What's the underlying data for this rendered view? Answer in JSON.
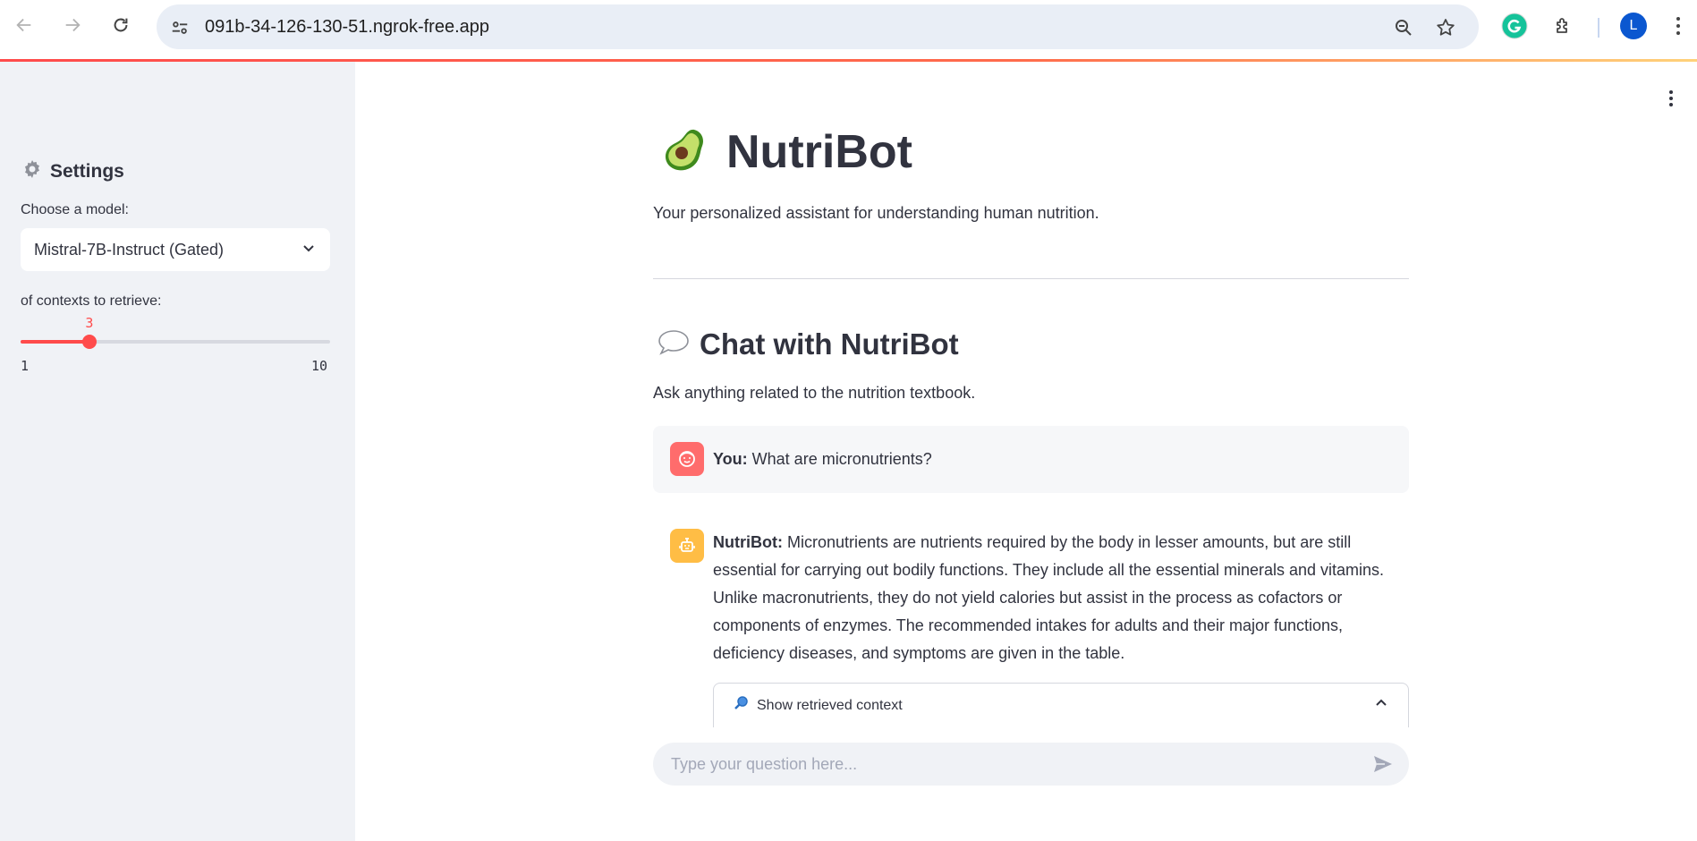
{
  "browser": {
    "url": "091b-34-126-130-51.ngrok-free.app",
    "profile_initial": "L",
    "colors": {
      "omnibox_bg": "#e9eef6",
      "profile": "#0b57d0",
      "grammarly": "#15c39a"
    }
  },
  "sidebar": {
    "title": "Settings",
    "title_icon": "gear-icon",
    "model_label": "Choose a model:",
    "model_selected": "Mistral-7B-Instruct (Gated)",
    "contexts_label": "of contexts to retrieve:",
    "slider": {
      "value": "3",
      "min": "1",
      "max": "10",
      "fraction": 0.2222
    }
  },
  "main": {
    "title": "NutriBot",
    "title_icon": "avocado-icon",
    "subtitle": "Your personalized assistant for understanding human nutrition.",
    "chat_heading": "Chat with NutriBot",
    "chat_heading_icon": "speech-bubble-icon",
    "chat_sub": "Ask anything related to the nutrition textbook.",
    "messages": [
      {
        "role_label": "You:",
        "text": "What are micronutrients?",
        "avatar_icon": "user-face-icon"
      },
      {
        "role_label": "NutriBot:",
        "text": "Micronutrients are nutrients required by the body in lesser amounts, but are still essential for carrying out bodily functions. They include all the essential minerals and vitamins. Unlike macronutrients, they do not yield calories but assist in the process as cofactors or components of enzymes. The recommended intakes for adults and their major functions, deficiency diseases, and symptoms are given in the table.",
        "avatar_icon": "robot-icon"
      }
    ],
    "context_expander": "Show retrieved context",
    "input_placeholder": "Type your question here..."
  },
  "colors": {
    "accent": "#ff4b4b",
    "sidebar_bg": "#f0f2f6",
    "text": "#31333f",
    "user_avatar": "#ff6c6c",
    "bot_avatar": "#ffbd45"
  }
}
